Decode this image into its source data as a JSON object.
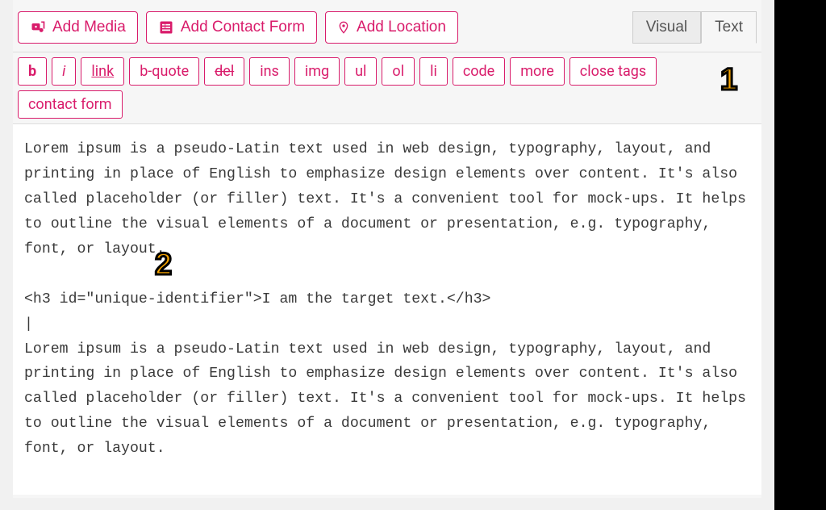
{
  "media_bar": {
    "add_media": "Add Media",
    "add_contact_form": "Add Contact Form",
    "add_location": "Add Location"
  },
  "tabs": {
    "visual": "Visual",
    "text": "Text",
    "active": "text"
  },
  "quicktags": {
    "b": "b",
    "i": "i",
    "link": "link",
    "bquote": "b-quote",
    "del": "del",
    "ins": "ins",
    "img": "img",
    "ul": "ul",
    "ol": "ol",
    "li": "li",
    "code": "code",
    "more": "more",
    "close": "close tags",
    "contact_form": "contact form"
  },
  "editor": {
    "content": "Lorem ipsum is a pseudo-Latin text used in web design, typography, layout, and printing in place of English to emphasize design elements over content. It's also called placeholder (or filler) text. It's a convenient tool for mock-ups. It helps to outline the visual elements of a document or presentation, e.g. typography, font, or layout.\n\n<h3 id=\"unique-identifier\">I am the target text.</h3>\n|\nLorem ipsum is a pseudo-Latin text used in web design, typography, layout, and printing in place of English to emphasize design elements over content. It's also called placeholder (or filler) text. It's a convenient tool for mock-ups. It helps to outline the visual elements of a document or presentation, e.g. typography, font, or layout."
  },
  "markers": {
    "one": "1",
    "two": "2"
  },
  "colors": {
    "accent": "#d91c6b",
    "marker_fill": "#f5a300"
  }
}
